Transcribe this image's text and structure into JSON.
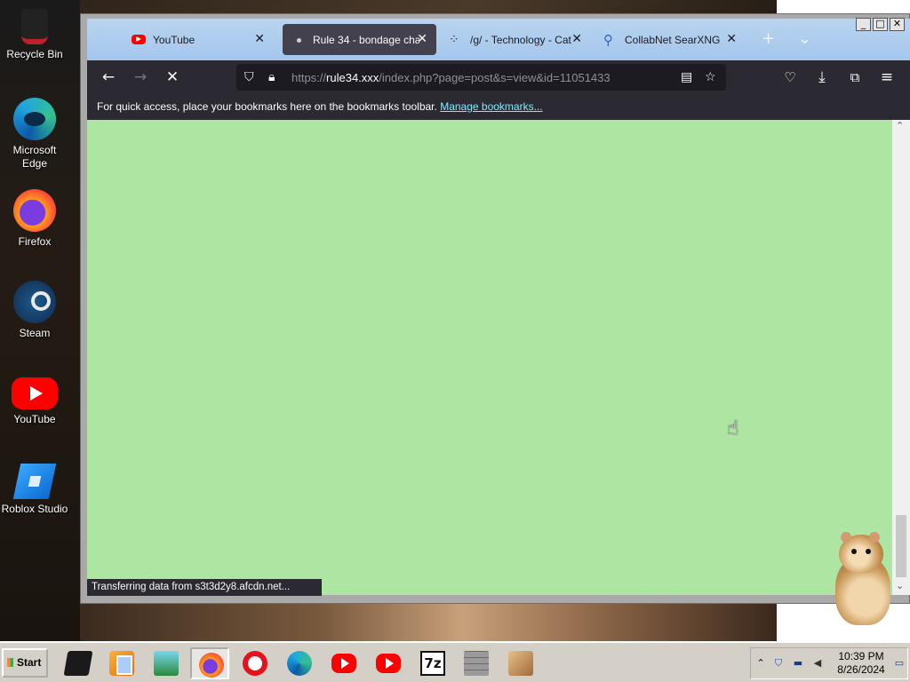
{
  "desktop": {
    "icons": [
      {
        "name": "Recycle Bin",
        "icon": "recycle-bin-icon"
      },
      {
        "name": "Microsoft Edge",
        "icon": "edge-icon"
      },
      {
        "name": "Firefox",
        "icon": "firefox-icon"
      },
      {
        "name": "Steam",
        "icon": "steam-icon"
      },
      {
        "name": "YouTube",
        "icon": "youtube-icon"
      },
      {
        "name": "Roblox Studio",
        "icon": "roblox-studio-icon"
      }
    ]
  },
  "window": {
    "controls": {
      "minimize": "_",
      "maximize": "□",
      "close": "✕"
    }
  },
  "browser": {
    "tabs": [
      {
        "title": "YouTube",
        "icon": "youtube-favicon",
        "close": "✕",
        "active": false
      },
      {
        "title": "Rule 34 - bondage cha",
        "icon": "loading-dot-favicon",
        "close": "✕",
        "active": true
      },
      {
        "title": "/g/ - Technology - Cat",
        "icon": "grid-favicon",
        "close": "✕",
        "active": false
      },
      {
        "title": "CollabNet SearXNG",
        "icon": "search-favicon",
        "close": "✕",
        "active": false
      }
    ],
    "new_tab": "+",
    "tab_list": "⌄",
    "nav": {
      "back": "←",
      "forward": "→",
      "stop": "✕"
    },
    "url": {
      "scheme": "https://",
      "host": "rule34.xxx",
      "path": "/index.php?page=post&s=view&id=11051433"
    },
    "toolbar_icons": [
      "reader-view-icon",
      "bookmark-star-icon",
      "pocket-icon",
      "downloads-icon",
      "extensions-icon",
      "menu-icon"
    ],
    "bookmarks_bar": {
      "message": "For quick access, place your bookmarks here on the bookmarks toolbar.",
      "link": "Manage bookmarks..."
    },
    "page_background": "#ade5a2",
    "status": "Transferring data from s3t3d2y8.afcdn.net..."
  },
  "taskbar": {
    "start_label": "Start",
    "apps": [
      "terminal-icon",
      "media-player-icon",
      "winscp-icon",
      "firefox-icon",
      "opera-icon",
      "edge-icon",
      "youtube-icon",
      "youtube-icon",
      "7zip-icon",
      "wall-icon",
      "app-icon"
    ],
    "clock": {
      "time": "10:39 PM",
      "date": "8/26/2024"
    }
  },
  "colors": {
    "tab_bar": "#a4c6ec",
    "toolbar": "#2b2a33",
    "link": "#80ebff"
  }
}
